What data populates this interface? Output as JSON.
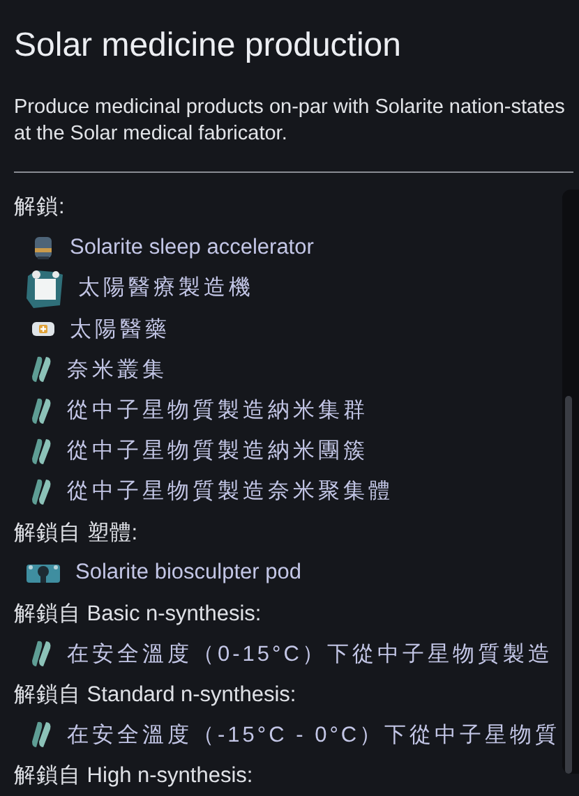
{
  "title": "Solar medicine production",
  "description": "Produce medicinal products on-par with Solarite nation-states at the Solar medical fabricator.",
  "sections": [
    {
      "heading": "解鎖:",
      "items": [
        {
          "kind": "bed",
          "label": "Solarite sleep accelerator"
        },
        {
          "kind": "fabricator",
          "label": "太陽醫療製造機"
        },
        {
          "kind": "drug",
          "label": "太陽醫藥"
        },
        {
          "kind": "recipe",
          "label": "奈米叢集"
        },
        {
          "kind": "recipe",
          "label": "從中子星物質製造納米集群"
        },
        {
          "kind": "recipe",
          "label": "從中子星物質製造納米團簇"
        },
        {
          "kind": "recipe",
          "label": "從中子星物質製造奈米聚集體"
        }
      ]
    },
    {
      "heading": "解鎖自 塑體:",
      "items": [
        {
          "kind": "pod",
          "label": "Solarite biosculpter pod"
        }
      ]
    },
    {
      "heading": "解鎖自 Basic n-synthesis:",
      "items": [
        {
          "kind": "recipe",
          "label": "在安全溫度（0-15°C）下從中子星物質製造"
        }
      ]
    },
    {
      "heading": "解鎖自 Standard n-synthesis:",
      "items": [
        {
          "kind": "recipe",
          "label": "在安全溫度（-15°C - 0°C）下從中子星物質"
        }
      ]
    },
    {
      "heading": "解鎖自 High n-synthesis:"
    }
  ]
}
